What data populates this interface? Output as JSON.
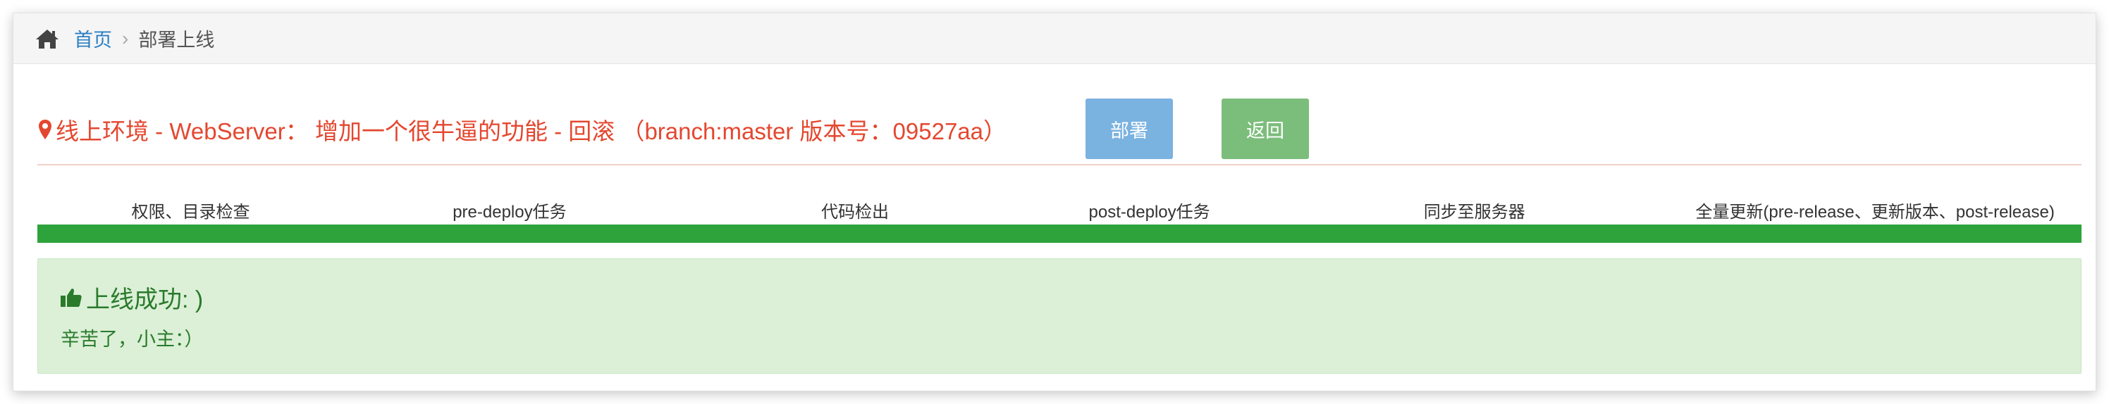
{
  "breadcrumb": {
    "home_icon": "home-icon",
    "home_label": "首页",
    "separator": "›",
    "current": "部署上线"
  },
  "header": {
    "title_icon": "map-marker-icon",
    "title": "线上环境 - WebServer： 增加一个很牛逼的功能 - 回滚 （branch:master 版本号：09527aa）",
    "deploy_label": "部署",
    "back_label": "返回"
  },
  "steps": [
    {
      "label": "权限、目录检查"
    },
    {
      "label": "pre-deploy任务"
    },
    {
      "label": "代码检出"
    },
    {
      "label": "post-deploy任务"
    },
    {
      "label": "同步至服务器"
    },
    {
      "label": "全量更新(pre-release、更新版本、post-release)"
    }
  ],
  "progress": {
    "percent": 100
  },
  "alert": {
    "icon": "thumbs-up-icon",
    "title": "上线成功: )",
    "message": "辛苦了，小主：）"
  },
  "colors": {
    "title_red": "#e4472f",
    "link_blue": "#2a7fc4",
    "deploy_button": "#7ab2e0",
    "back_button": "#7bbd7a",
    "progress_green": "#2ea33b",
    "alert_bg": "#dbf0d6",
    "alert_text": "#2a7a2c"
  }
}
